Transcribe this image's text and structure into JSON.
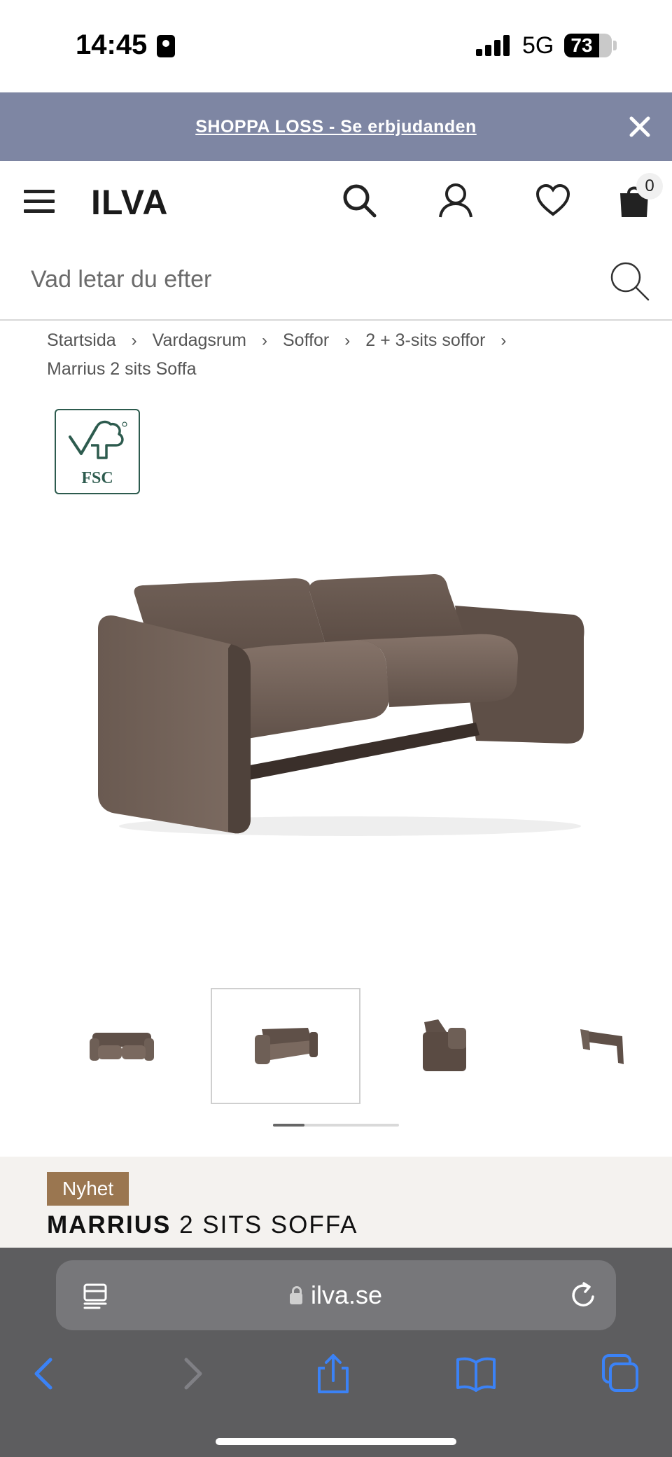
{
  "status_bar": {
    "time": "14:45",
    "network": "5G",
    "battery": "73",
    "battery_level": 0.73
  },
  "promo": {
    "text": "SHOPPA LOSS - Se erbjudanden"
  },
  "header": {
    "logo": "ILVA",
    "cart_count": "0"
  },
  "search": {
    "placeholder": "Vad letar du efter"
  },
  "breadcrumb": {
    "items": [
      "Startsida",
      "Vardagsrum",
      "Soffor",
      "2 + 3-sits soffor"
    ],
    "separator": "›",
    "current": "Marrius 2 sits Soffa"
  },
  "fsc": {
    "label": "FSC"
  },
  "product": {
    "badge": "Nyhet",
    "title_bold": "MARRIUS",
    "title_rest": "2 SITS SOFFA",
    "color": "#6e5f56",
    "active_thumbnail": 2,
    "thumbnail_count": 4
  },
  "gallery": {
    "scroll_progress": 0.25
  },
  "browser": {
    "url": "ilva.se"
  },
  "icons": {
    "menu": "menu-icon",
    "search": "search-icon",
    "account": "user-icon",
    "wishlist": "heart-icon",
    "cart": "bag-icon",
    "close": "close-icon",
    "reader": "reader-icon",
    "lock": "lock-icon",
    "reload": "reload-icon",
    "back": "back-icon",
    "forward": "forward-icon",
    "share": "share-icon",
    "bookmarks": "bookmarks-icon",
    "tabs": "tabs-icon"
  },
  "colors": {
    "promo_bg": "#7e86a3",
    "badge_bg": "#9a7650",
    "safari_blue": "#3b82f6"
  }
}
